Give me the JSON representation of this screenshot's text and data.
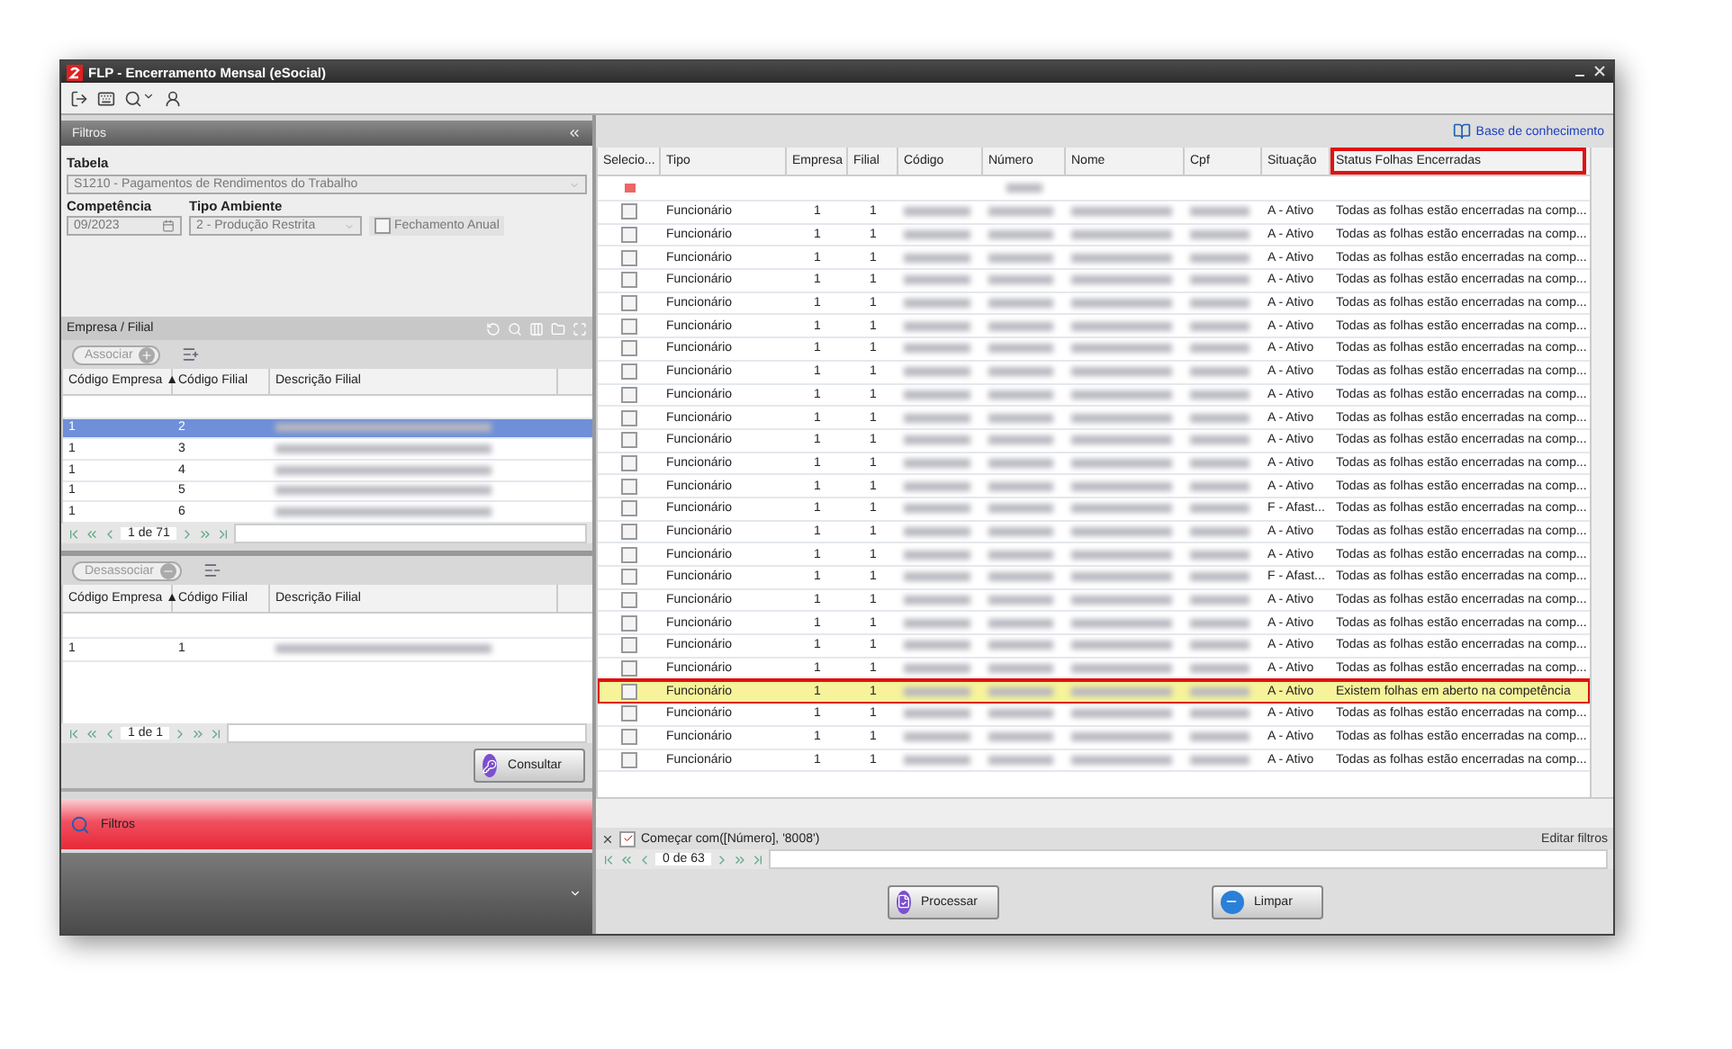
{
  "window": {
    "title": "FLP - Encerramento Mensal (eSocial)"
  },
  "filters_panel": {
    "title": "Filtros",
    "tabela_label": "Tabela",
    "tabela_value": "S1210 - Pagamentos de Rendimentos do Trabalho",
    "competencia_label": "Competência",
    "competencia_value": "09/2023",
    "tipo_ambiente_label": "Tipo Ambiente",
    "tipo_ambiente_value": "2 - Produção Restrita",
    "fechamento_anual": {
      "label": "Fechamento Anual",
      "checked": false
    }
  },
  "empresa_filial": {
    "title": "Empresa / Filial",
    "associar_button": "Associar",
    "columns": [
      "Código Empresa ▲",
      "Código Filial",
      "Descrição Filial"
    ],
    "rows": [
      {
        "empresa": "1",
        "filial": "2",
        "selected": true
      },
      {
        "empresa": "1",
        "filial": "3",
        "selected": false
      },
      {
        "empresa": "1",
        "filial": "4",
        "selected": false
      },
      {
        "empresa": "1",
        "filial": "5",
        "selected": false
      },
      {
        "empresa": "1",
        "filial": "6",
        "selected": false
      }
    ],
    "pager": "1 de 71"
  },
  "associated": {
    "desassociar_button": "Desassociar",
    "columns": [
      "Código Empresa ▲",
      "Código Filial",
      "Descrição Filial"
    ],
    "rows": [
      {
        "empresa": "1",
        "filial": "1",
        "selected": false
      }
    ],
    "pager": "1 de 1"
  },
  "consultar_button": "Consultar",
  "nav": {
    "label": "Filtros",
    "selected": true
  },
  "results": {
    "link": "Base de conhecimento",
    "columns": [
      {
        "label": "Selecio...",
        "highlighted": false
      },
      {
        "label": "Tipo",
        "highlighted": false
      },
      {
        "label": "Empresa",
        "highlighted": false
      },
      {
        "label": "Filial",
        "highlighted": false
      },
      {
        "label": "Código",
        "highlighted": false
      },
      {
        "label": "Número",
        "highlighted": false
      },
      {
        "label": "Nome",
        "highlighted": false
      },
      {
        "label": "Cpf",
        "highlighted": false
      },
      {
        "label": "Situação",
        "highlighted": false
      },
      {
        "label": "Status Folhas Encerradas",
        "highlighted": true
      }
    ],
    "rows": [
      {
        "tipo": "Funcionário",
        "empresa": "1",
        "filial": "1",
        "situacao": "A - Ativo",
        "status": "Todas as folhas estão encerradas na comp...",
        "checked": false,
        "highlighted": false
      },
      {
        "tipo": "Funcionário",
        "empresa": "1",
        "filial": "1",
        "situacao": "A - Ativo",
        "status": "Todas as folhas estão encerradas na comp...",
        "checked": false,
        "highlighted": false
      },
      {
        "tipo": "Funcionário",
        "empresa": "1",
        "filial": "1",
        "situacao": "A - Ativo",
        "status": "Todas as folhas estão encerradas na comp...",
        "checked": false,
        "highlighted": false
      },
      {
        "tipo": "Funcionário",
        "empresa": "1",
        "filial": "1",
        "situacao": "A - Ativo",
        "status": "Todas as folhas estão encerradas na comp...",
        "checked": false,
        "highlighted": false
      },
      {
        "tipo": "Funcionário",
        "empresa": "1",
        "filial": "1",
        "situacao": "A - Ativo",
        "status": "Todas as folhas estão encerradas na comp...",
        "checked": false,
        "highlighted": false
      },
      {
        "tipo": "Funcionário",
        "empresa": "1",
        "filial": "1",
        "situacao": "A - Ativo",
        "status": "Todas as folhas estão encerradas na comp...",
        "checked": false,
        "highlighted": false
      },
      {
        "tipo": "Funcionário",
        "empresa": "1",
        "filial": "1",
        "situacao": "A - Ativo",
        "status": "Todas as folhas estão encerradas na comp...",
        "checked": false,
        "highlighted": false
      },
      {
        "tipo": "Funcionário",
        "empresa": "1",
        "filial": "1",
        "situacao": "A - Ativo",
        "status": "Todas as folhas estão encerradas na comp...",
        "checked": false,
        "highlighted": false
      },
      {
        "tipo": "Funcionário",
        "empresa": "1",
        "filial": "1",
        "situacao": "A - Ativo",
        "status": "Todas as folhas estão encerradas na comp...",
        "checked": false,
        "highlighted": false
      },
      {
        "tipo": "Funcionário",
        "empresa": "1",
        "filial": "1",
        "situacao": "A - Ativo",
        "status": "Todas as folhas estão encerradas na comp...",
        "checked": false,
        "highlighted": false
      },
      {
        "tipo": "Funcionário",
        "empresa": "1",
        "filial": "1",
        "situacao": "A - Ativo",
        "status": "Todas as folhas estão encerradas na comp...",
        "checked": false,
        "highlighted": false
      },
      {
        "tipo": "Funcionário",
        "empresa": "1",
        "filial": "1",
        "situacao": "A - Ativo",
        "status": "Todas as folhas estão encerradas na comp...",
        "checked": false,
        "highlighted": false
      },
      {
        "tipo": "Funcionário",
        "empresa": "1",
        "filial": "1",
        "situacao": "A - Ativo",
        "status": "Todas as folhas estão encerradas na comp...",
        "checked": false,
        "highlighted": false
      },
      {
        "tipo": "Funcionário",
        "empresa": "1",
        "filial": "1",
        "situacao": "F - Afast...",
        "status": "Todas as folhas estão encerradas na comp...",
        "checked": false,
        "highlighted": false
      },
      {
        "tipo": "Funcionário",
        "empresa": "1",
        "filial": "1",
        "situacao": "A - Ativo",
        "status": "Todas as folhas estão encerradas na comp...",
        "checked": false,
        "highlighted": false
      },
      {
        "tipo": "Funcionário",
        "empresa": "1",
        "filial": "1",
        "situacao": "A - Ativo",
        "status": "Todas as folhas estão encerradas na comp...",
        "checked": false,
        "highlighted": false
      },
      {
        "tipo": "Funcionário",
        "empresa": "1",
        "filial": "1",
        "situacao": "F - Afast...",
        "status": "Todas as folhas estão encerradas na comp...",
        "checked": false,
        "highlighted": false
      },
      {
        "tipo": "Funcionário",
        "empresa": "1",
        "filial": "1",
        "situacao": "A - Ativo",
        "status": "Todas as folhas estão encerradas na comp...",
        "checked": false,
        "highlighted": false
      },
      {
        "tipo": "Funcionário",
        "empresa": "1",
        "filial": "1",
        "situacao": "A - Ativo",
        "status": "Todas as folhas estão encerradas na comp...",
        "checked": false,
        "highlighted": false
      },
      {
        "tipo": "Funcionário",
        "empresa": "1",
        "filial": "1",
        "situacao": "A - Ativo",
        "status": "Todas as folhas estão encerradas na comp...",
        "checked": false,
        "highlighted": false
      },
      {
        "tipo": "Funcionário",
        "empresa": "1",
        "filial": "1",
        "situacao": "A - Ativo",
        "status": "Todas as folhas estão encerradas na comp...",
        "checked": false,
        "highlighted": false
      },
      {
        "tipo": "Funcionário",
        "empresa": "1",
        "filial": "1",
        "situacao": "A - Ativo",
        "status": "Existem folhas em aberto na competência",
        "checked": false,
        "highlighted": true
      },
      {
        "tipo": "Funcionário",
        "empresa": "1",
        "filial": "1",
        "situacao": "A - Ativo",
        "status": "Todas as folhas estão encerradas na comp...",
        "checked": false,
        "highlighted": false
      },
      {
        "tipo": "Funcionário",
        "empresa": "1",
        "filial": "1",
        "situacao": "A - Ativo",
        "status": "Todas as folhas estão encerradas na comp...",
        "checked": false,
        "highlighted": false
      },
      {
        "tipo": "Funcionário",
        "empresa": "1",
        "filial": "1",
        "situacao": "A - Ativo",
        "status": "Todas as folhas estão encerradas na comp...",
        "checked": false,
        "highlighted": false
      }
    ],
    "filter": {
      "checked": true,
      "text": "Começar com([Número], '8008')",
      "edit": "Editar filtros"
    },
    "pager": "0 de 63"
  },
  "buttons": [
    {
      "kind": "process",
      "label": "Processar"
    },
    {
      "kind": "clear",
      "label": "Limpar"
    }
  ]
}
